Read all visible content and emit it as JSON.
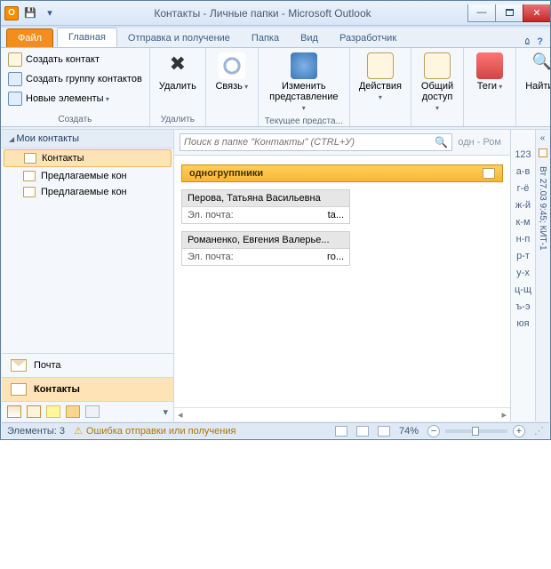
{
  "titlebar": {
    "title": "Контакты - Личные папки - Microsoft Outlook"
  },
  "tabs": {
    "file": "Файл",
    "home": "Главная",
    "sendrecv": "Отправка и получение",
    "folder": "Папка",
    "view": "Вид",
    "dev": "Разработчик"
  },
  "ribbon": {
    "g_new": {
      "new_contact": "Создать контакт",
      "new_group": "Создать группу контактов",
      "new_items": "Новые элементы",
      "label": "Создать"
    },
    "g_delete": {
      "btn": "Удалить",
      "label": "Удалить"
    },
    "g_comm": {
      "btn": "Связь",
      "label": ""
    },
    "g_view": {
      "btn": "Изменить представление",
      "label": "Текущее предста..."
    },
    "g_actions": {
      "btn": "Действия",
      "label": ""
    },
    "g_share": {
      "btn": "Общий доступ",
      "label": ""
    },
    "g_tags": {
      "btn": "Теги",
      "label": ""
    },
    "g_find": {
      "btn": "Найти",
      "label": ""
    }
  },
  "nav": {
    "header": "Мои контакты",
    "items": [
      "Контакты",
      "Предлагаемые кон",
      "Предлагаемые кон"
    ],
    "mail": "Почта",
    "contacts": "Контакты"
  },
  "search": {
    "placeholder": "Поиск в папке \"Контакты\" (CTRL+У)",
    "scope": "одн - Ром"
  },
  "category": "одногруппники",
  "cards": [
    {
      "name": "Перова, Татьяна Васильевна",
      "email_lbl": "Эл. почта:",
      "email_val": "ta..."
    },
    {
      "name": "Романенко, Евгения Валерье...",
      "email_lbl": "Эл. почта:",
      "email_val": "го..."
    }
  ],
  "alpha": [
    "123",
    "а-в",
    "г-ё",
    "ж-й",
    "к-м",
    "н-п",
    "р-т",
    "у-х",
    "ц-щ",
    "ъ-э",
    "юя"
  ],
  "todo": {
    "date": "Вт 27.03 9:45; КИТ-1"
  },
  "status": {
    "items": "Элементы: 3",
    "warn": "Ошибка отправки или получения",
    "zoom": "74%"
  }
}
